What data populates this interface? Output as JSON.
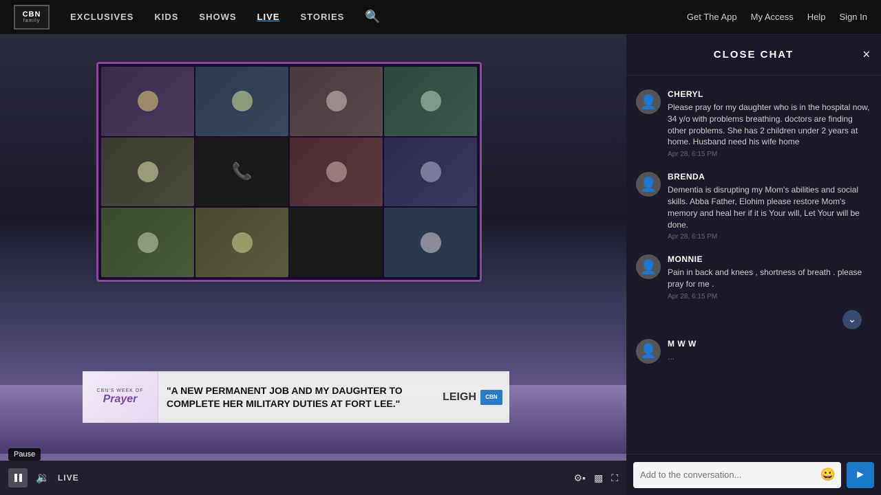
{
  "header": {
    "logo_cbn": "CBN",
    "logo_family": "family",
    "nav": [
      {
        "label": "EXCLUSIVES",
        "id": "exclusives"
      },
      {
        "label": "KIDS",
        "id": "kids"
      },
      {
        "label": "SHOWS",
        "id": "shows"
      },
      {
        "label": "LIVE",
        "id": "live",
        "active": true
      },
      {
        "label": "STORIES",
        "id": "stories"
      }
    ],
    "get_app": "Get The App",
    "my_access": "My Access",
    "help": "Help",
    "sign_in": "Sign In"
  },
  "video": {
    "live_label": "LIVE",
    "pause_tooltip": "Pause",
    "lower_third": {
      "logo_pre": "CBN'S WEEK of",
      "logo_main": "Prayer",
      "quote": "\"A NEW PERMANENT JOB AND MY DAUGHTER TO COMPLETE HER MILITARY DUTIES AT FORT LEE.\"",
      "name": "LEIGH",
      "cbn_badge": "CBN"
    }
  },
  "chat": {
    "title": "CLOSE CHAT",
    "close_label": "×",
    "messages": [
      {
        "username": "Cheryl",
        "text": "Please pray for my daughter who is in the hospital now, 34 y&#47;o with problems breathing. doctors are finding other problems. She has 2 children under 2 years at home. Husband need his wife home",
        "time": "Apr 28, 6:15 PM"
      },
      {
        "username": "BRENDA",
        "text": "Dementia is disrupting my Mom's abilities and social skills. Abba Father, Elohim please restore Mom's memory and heal her if it is Your will, Let Your will be done.",
        "time": "Apr 28, 6:15 PM"
      },
      {
        "username": "Monnie",
        "text": "Pain in back and knees , shortness of breath . please pray for me .",
        "time": "Apr 28, 6:15 PM"
      },
      {
        "username": "m w w",
        "text": "...",
        "time": ""
      }
    ],
    "input_placeholder": "Add to the conversation...",
    "send_label": "➤"
  }
}
